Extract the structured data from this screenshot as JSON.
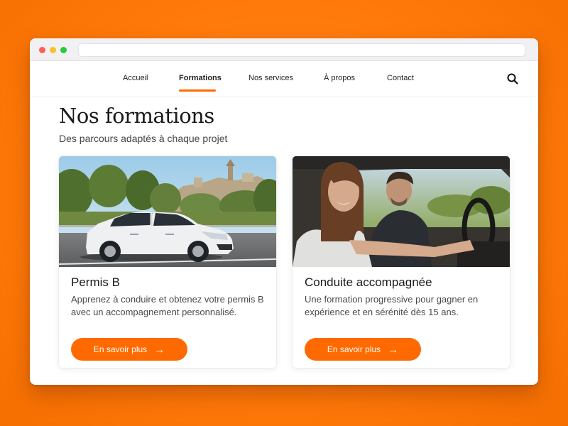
{
  "nav": {
    "items": [
      {
        "label": "Accueil"
      },
      {
        "label": "Formations",
        "active": true
      },
      {
        "label": "Nos services"
      },
      {
        "label": "À propos"
      },
      {
        "label": "Contact"
      }
    ],
    "search_icon": "search-icon"
  },
  "page": {
    "title": "Nos formations",
    "subtitle": "Des parcours adaptés à chaque projet"
  },
  "cards": [
    {
      "title": "Permis B",
      "description": "Apprenez à conduire et obtenez votre permis B avec un accompagnement personnalisé.",
      "button": "En savoir plus",
      "image": "white-car-photo"
    },
    {
      "title": "Conduite accompagnée",
      "description": "Une formation progressive pour gagner en expérience et en sérénité dès 15 ans.",
      "button": "En savoir plus",
      "image": "driver-and-instructor-photo"
    }
  ],
  "colors": {
    "accent": "#ff6a00",
    "background": "#ff7a0a"
  }
}
